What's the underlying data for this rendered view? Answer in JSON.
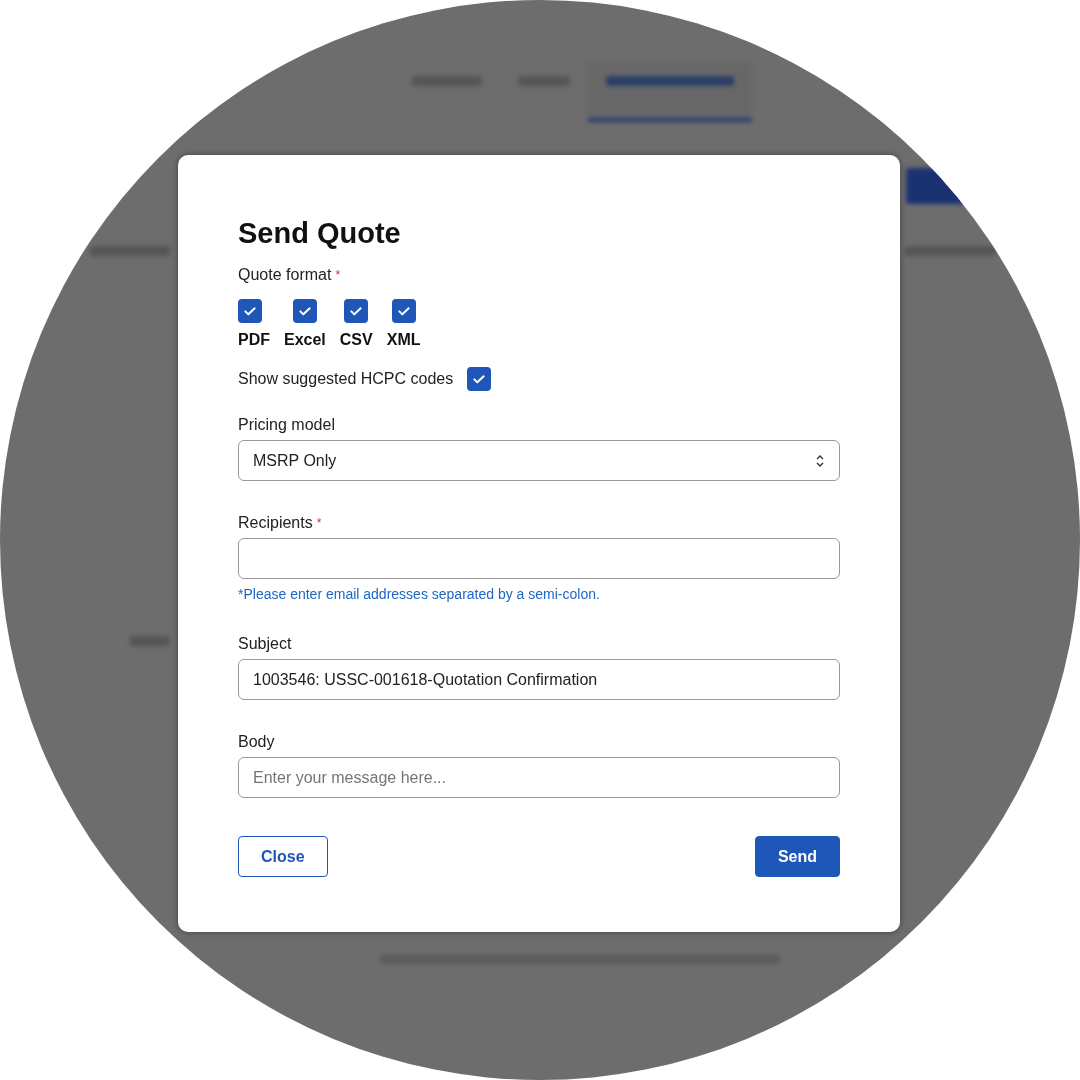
{
  "background": {
    "tabs": [
      {
        "selected": false
      },
      {
        "selected": false
      },
      {
        "selected": true
      }
    ]
  },
  "dialog": {
    "title": "Send Quote",
    "quote_format": {
      "label": "Quote format",
      "required_mark": "*",
      "options": [
        {
          "label": "PDF",
          "checked": true
        },
        {
          "label": "Excel",
          "checked": true
        },
        {
          "label": "CSV",
          "checked": true
        },
        {
          "label": "XML",
          "checked": true
        }
      ]
    },
    "hcpc": {
      "label": "Show suggested HCPC codes",
      "checked": true
    },
    "pricing_model": {
      "label": "Pricing model",
      "value": "MSRP Only"
    },
    "recipients": {
      "label": "Recipients",
      "required_mark": "*",
      "hint": "*Please enter email addresses separated by a semi-colon."
    },
    "subject": {
      "label": "Subject",
      "value": "1003546: USSC-001618-Quotation Confirmation"
    },
    "body": {
      "label": "Body",
      "placeholder": "Enter your message here..."
    },
    "buttons": [
      {
        "label": "Close",
        "kind": "secondary"
      },
      {
        "label": "Send",
        "kind": "primary"
      }
    ]
  }
}
